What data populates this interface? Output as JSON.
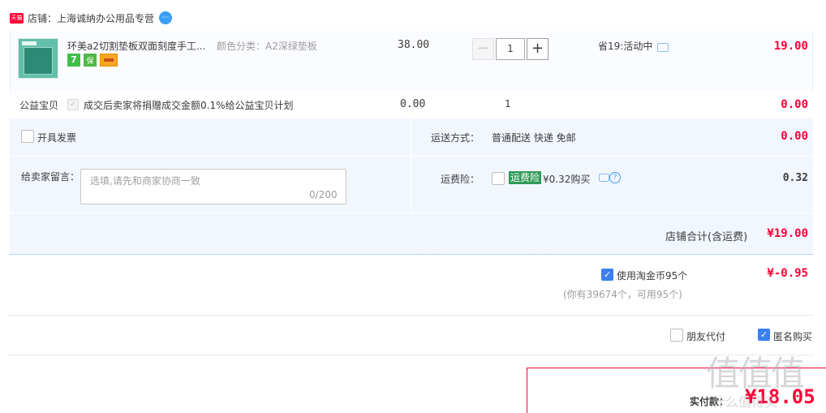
{
  "shop": {
    "badge": "天猫",
    "name": "店铺：上海诚纳办公用品专营",
    "ww_icon": "chat-bubble-icon"
  },
  "item": {
    "title": "环美a2切割垫板双面刻度手工...",
    "sku_label": "颜色分类：",
    "sku_value": "A2深绿垫板",
    "service_7": "7",
    "service_b": "保",
    "unit_price": "38.00",
    "quantity": "1",
    "minus": "−",
    "plus": "+",
    "promo": "省19:活动中",
    "total": "19.00"
  },
  "charity": {
    "label": "公益宝贝",
    "text": "成交后卖家将捐赠成交金额0.1%给公益宝贝计划",
    "price": "0.00",
    "qty": "1",
    "total": "0.00"
  },
  "invoice": {
    "label": "开具发票"
  },
  "shipping": {
    "label": "运送方式：",
    "value": "普通配送 快递 免邮",
    "total": "0.00"
  },
  "message": {
    "label": "给卖家留言：",
    "placeholder": "选填,请先和商家协商一致",
    "count": "0/200"
  },
  "insurance": {
    "label": "运费险：",
    "tag": "运费险",
    "text": "¥0.32购买",
    "help": "?",
    "total": "0.32"
  },
  "shop_total": {
    "label": "店铺合计(含运费)",
    "value": "¥19.00"
  },
  "coins": {
    "check": "✓",
    "label": "使用淘金币95个",
    "sub": "(你有39674个，可用95个)",
    "discount": "¥-0.95"
  },
  "options": {
    "friend_pay": "朋友代付",
    "anonymous": "匿名购买",
    "anon_check": "✓"
  },
  "payment": {
    "label": "实付款：",
    "amount": "¥18.05"
  },
  "watermark": "值值值",
  "watermark_sub": "什么值得买"
}
